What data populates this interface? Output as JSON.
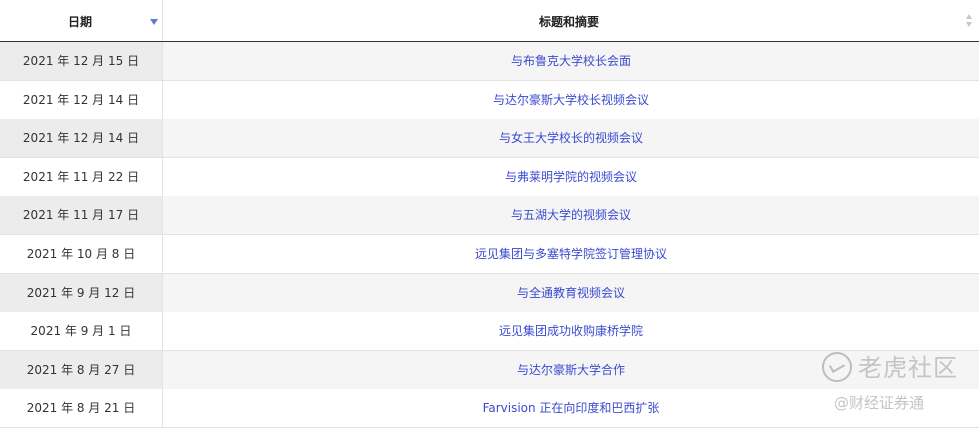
{
  "table": {
    "columns": {
      "date": "日期",
      "title": "标题和摘要"
    },
    "rows": [
      {
        "date": "2021 年 12 月 15 日",
        "title": "与布鲁克大学校长会面"
      },
      {
        "date": "2021 年 12 月 14 日",
        "title": "与达尔豪斯大学校长视频会议"
      },
      {
        "date": "2021 年 12 月 14 日",
        "title": "与女王大学校长的视频会议"
      },
      {
        "date": "2021 年 11 月 22 日",
        "title": "与弗莱明学院的视频会议"
      },
      {
        "date": "2021 年 11 月 17 日",
        "title": "与五湖大学的视频会议"
      },
      {
        "date": "2021 年 10 月 8 日",
        "title": "远见集团与多塞特学院签订管理协议"
      },
      {
        "date": "2021 年 9 月 12 日",
        "title": "与全通教育视频会议"
      },
      {
        "date": "2021 年 9 月 1 日",
        "title": "远见集团成功收购康桥学院"
      },
      {
        "date": "2021 年 8 月 27 日",
        "title": "与达尔豪斯大学合作"
      },
      {
        "date": "2021 年 8 月 21 日",
        "title": "Farvision 正在向印度和巴西扩张"
      }
    ]
  },
  "watermark": {
    "main": "老虎社区",
    "sub": "@财经证券通"
  },
  "colors": {
    "link": "#3a4bd0",
    "sort_active": "#5b7bd8",
    "row_alt": "#f5f5f5"
  }
}
